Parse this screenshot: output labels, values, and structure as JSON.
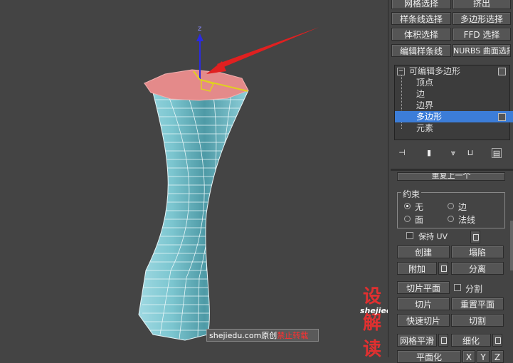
{
  "modifier_buttons": {
    "mesh_select": "网格选择",
    "extrude": "挤出",
    "spline_select": "样条线选择",
    "poly_select": "多边形选择",
    "volume_select": "体积选择",
    "ffd_select": "FFD 选择",
    "edit_spline": "编辑样条线",
    "nurbs_surface_select": "NURBS 曲面选择"
  },
  "stack": {
    "root": "可编辑多边形",
    "items": [
      "顶点",
      "边",
      "边界",
      "多边形",
      "元素"
    ],
    "selected_index": 3
  },
  "rollout": {
    "cut_header": "重复上一个",
    "constraints_title": "约束",
    "constraints": [
      {
        "label": "无",
        "checked": true
      },
      {
        "label": "边",
        "checked": false
      },
      {
        "label": "面",
        "checked": false
      },
      {
        "label": "法线",
        "checked": false
      }
    ],
    "preserve_uv": "保持 UV",
    "create": "创建",
    "collapse": "塌陷",
    "attach": "附加",
    "detach": "分离",
    "slice_plane": "切片平面",
    "split": "分割",
    "slice": "切片",
    "reset_plane": "重置平面",
    "quickslice": "快速切片",
    "cut": "切割",
    "meshsmooth": "网格平滑",
    "tessellate": "细化",
    "planarize": "平面化",
    "x": "X",
    "y": "Y",
    "z": "Z"
  },
  "gizmo_z_label": "z",
  "watermark": {
    "site": "shejiedu.com原创",
    "warning": "禁止转载",
    "logo": "设解读",
    "logo_url": "shejiedu.com"
  },
  "colors": {
    "object": "#7fc8d2",
    "top_face": "#e68080",
    "selection": "#3c7dd8",
    "arrow": "#e02020"
  }
}
